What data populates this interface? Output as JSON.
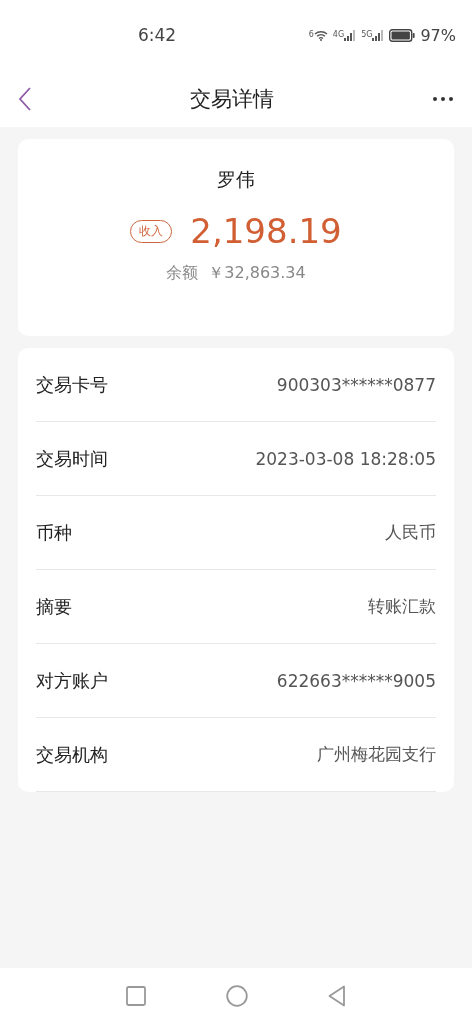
{
  "status_bar": {
    "time": "6:42",
    "wifi_label": "6",
    "network_labels": [
      "4G",
      "5G"
    ],
    "battery": "97%"
  },
  "header": {
    "title": "交易详情"
  },
  "summary": {
    "name": "罗伟",
    "tag": "收入",
    "amount": "2,198.19",
    "balance_label": "余额",
    "balance": "￥32,863.34"
  },
  "details": [
    {
      "label": "交易卡号",
      "value": "900303******0877"
    },
    {
      "label": "交易时间",
      "value": "2023-03-08 18:28:05"
    },
    {
      "label": "币种",
      "value": "人民币"
    },
    {
      "label": "摘要",
      "value": "转账汇款"
    },
    {
      "label": "对方账户",
      "value": "622663******9005"
    },
    {
      "label": "交易机构",
      "value": "广州梅花园支行"
    }
  ]
}
